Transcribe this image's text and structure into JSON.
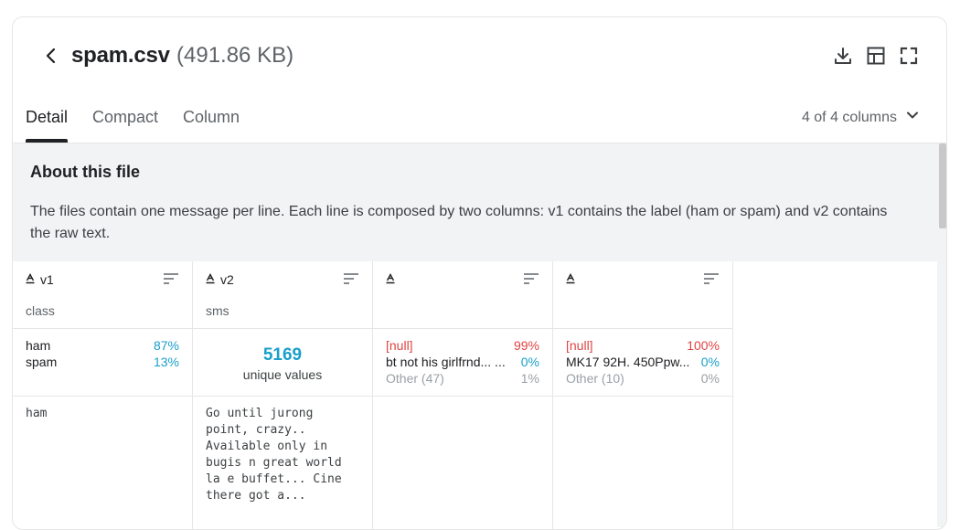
{
  "header": {
    "filename": "spam.csv",
    "filesize": "(491.86 KB)",
    "icons": [
      "back-arrow-icon",
      "download-icon",
      "table-icon",
      "fullscreen-icon"
    ]
  },
  "tabs": [
    {
      "label": "Detail",
      "active": true
    },
    {
      "label": "Compact",
      "active": false
    },
    {
      "label": "Column",
      "active": false
    }
  ],
  "column_selector": "4 of 4 columns",
  "about": {
    "title": "About this file",
    "text": "The files contain one message per line. Each line is composed by two columns: v1 contains the label (ham or spam) and v2 contains the raw text."
  },
  "columns": [
    {
      "name": "v1",
      "description": "class",
      "stats": [
        {
          "label": "ham",
          "pct": "87%"
        },
        {
          "label": "spam",
          "pct": "13%"
        }
      ],
      "first_value": "ham"
    },
    {
      "name": "v2",
      "description": "sms",
      "unique_count": "5169",
      "unique_label": "unique values",
      "first_value": "Go until jurong\npoint, crazy..\nAvailable only in\nbugis n great world\nla e buffet... Cine\nthere got a..."
    },
    {
      "name": "",
      "description": "",
      "stats": [
        {
          "label": "[null]",
          "pct": "99%"
        },
        {
          "label": "bt not his girlfrnd... ...",
          "pct": "0%"
        },
        {
          "label": "Other (47)",
          "pct": "1%"
        }
      ]
    },
    {
      "name": "",
      "description": "",
      "stats": [
        {
          "label": "[null]",
          "pct": "100%"
        },
        {
          "label": "MK17 92H. 450Ppw...",
          "pct": "0%"
        },
        {
          "label": "Other (10)",
          "pct": "0%"
        }
      ]
    }
  ],
  "colors": {
    "accent": "#1a9fc9",
    "null": "#e04444",
    "muted": "#9aa0a6"
  }
}
